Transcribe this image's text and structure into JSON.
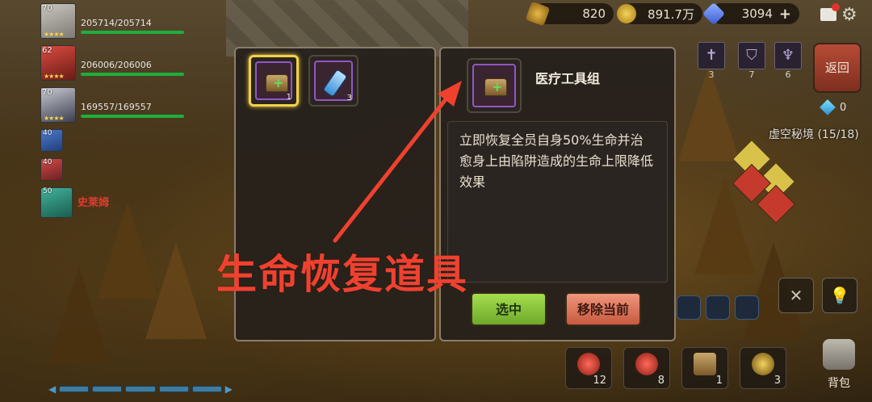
{
  "resources": {
    "wheat": "820",
    "gold": "891.7万",
    "gems": "3094",
    "gems_plus": "+"
  },
  "party": [
    {
      "level": "70",
      "name": "",
      "hp": "205714/205714"
    },
    {
      "level": "62",
      "name": "",
      "hp": "206006/206006"
    },
    {
      "level": "70",
      "name": "",
      "hp": "169557/169557"
    }
  ],
  "reserves": [
    {
      "level": "40",
      "name": "",
      "style": "blue"
    },
    {
      "level": "40",
      "name": "",
      "style": "red"
    },
    {
      "level": "50",
      "name": "史莱姆",
      "style": "green"
    }
  ],
  "skills": [
    {
      "icon": "sword-icon",
      "count": "3"
    },
    {
      "icon": "armor-icon",
      "count": "7"
    },
    {
      "icon": "crystal-icon",
      "count": "6"
    }
  ],
  "back_label": "返回",
  "crystal_count": "0",
  "dungeon": "虚空秘境 (15/18)",
  "items_panel": {
    "slots": [
      {
        "icon": "medical-chest-icon",
        "count": "1",
        "selected": true
      },
      {
        "icon": "blue-vial-icon",
        "count": "3",
        "selected": false
      }
    ]
  },
  "detail": {
    "title": "医疗工具组",
    "description": "立即恢复全员自身50%生命并治愈身上由陷阱造成的生命上限降低效果",
    "select_label": "选中",
    "remove_label": "移除当前"
  },
  "quickbar": [
    {
      "icon": "red-potion-icon",
      "count": "12"
    },
    {
      "icon": "red-potion-icon",
      "count": "8"
    },
    {
      "icon": "medical-chest-icon",
      "count": "1"
    },
    {
      "icon": "gold-orb-icon",
      "count": "3"
    }
  ],
  "bag_label": "背包",
  "annotation": "生命恢复道具",
  "colors": {
    "annotation": "#f0412f",
    "select_button": "#8ec43c",
    "remove_button": "#e07a5f",
    "selected_slot_border": "#f3d04a",
    "rarity_purple": "#9256c7"
  }
}
